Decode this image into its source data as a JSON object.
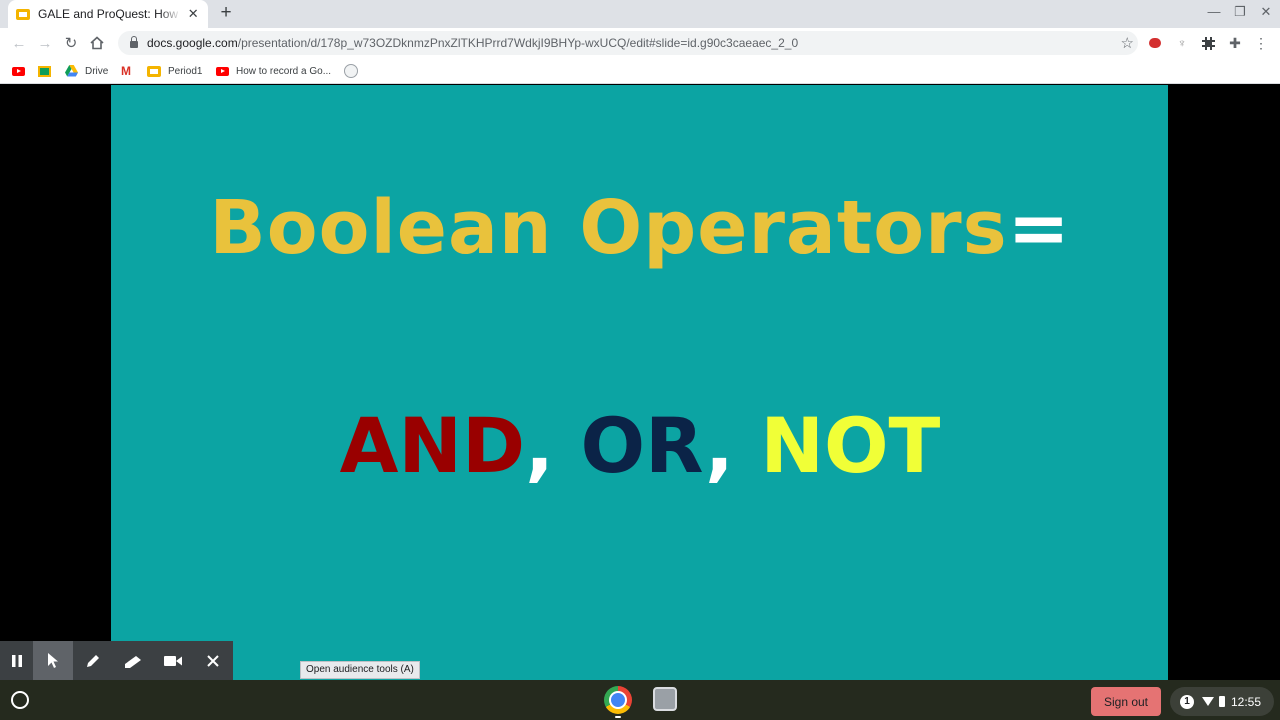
{
  "browser": {
    "tab": {
      "title": "GALE and ProQuest: How to conduct research"
    },
    "url": {
      "host": "docs.google.com",
      "path": "/presentation/d/178p_w73OZDknmzPnxZlTKHPrrd7WdkjI9BHYp-wxUCQ/edit#slide=id.g90c3caeaec_2_0"
    },
    "bookmarks": [
      {
        "label": "Drive"
      },
      {
        "label": "Period1"
      },
      {
        "label": "How to record a Go..."
      }
    ]
  },
  "slide": {
    "background": "#0ca4a3",
    "title": "Boolean Operators",
    "title_suffix": "=",
    "operators": [
      {
        "text": "AND",
        "color": "#990000"
      },
      {
        "text": "OR",
        "color": "#0b2347"
      },
      {
        "text": "NOT",
        "color": "#f0ff37"
      }
    ],
    "separator": ","
  },
  "presenter_tooltip": "Open audience tools (A)",
  "shelf": {
    "sign_out": "Sign out",
    "notification_count": "1",
    "time": "12:55"
  }
}
